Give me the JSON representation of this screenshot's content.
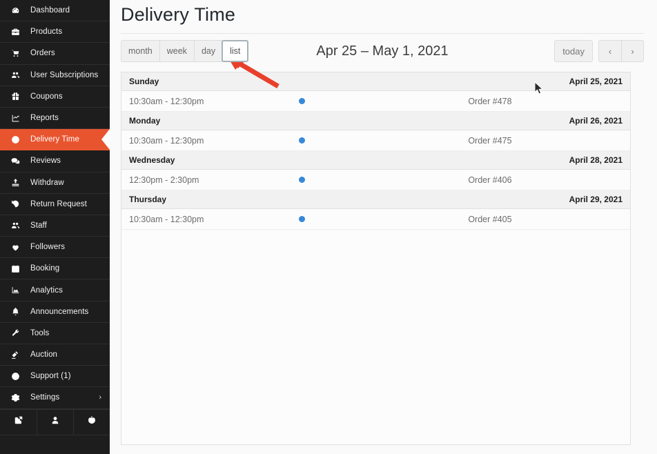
{
  "colors": {
    "sidebar_bg": "#1d1d1d",
    "accent": "#e8542e",
    "event_dot": "#3788d8",
    "annotation_arrow": "#e8402c"
  },
  "sidebar": {
    "items": [
      {
        "label": "Dashboard",
        "icon": "dashboard-icon",
        "active": false
      },
      {
        "label": "Products",
        "icon": "briefcase-icon",
        "active": false
      },
      {
        "label": "Orders",
        "icon": "cart-icon",
        "active": false
      },
      {
        "label": "User Subscriptions",
        "icon": "users-icon",
        "active": false
      },
      {
        "label": "Coupons",
        "icon": "gift-icon",
        "active": false
      },
      {
        "label": "Reports",
        "icon": "chart-line-icon",
        "active": false
      },
      {
        "label": "Delivery Time",
        "icon": "clock-icon",
        "active": true
      },
      {
        "label": "Reviews",
        "icon": "comment-icon",
        "active": false
      },
      {
        "label": "Withdraw",
        "icon": "upload-icon",
        "active": false
      },
      {
        "label": "Return Request",
        "icon": "undo-icon",
        "active": false
      },
      {
        "label": "Staff",
        "icon": "users-icon",
        "active": false
      },
      {
        "label": "Followers",
        "icon": "heart-icon",
        "active": false
      },
      {
        "label": "Booking",
        "icon": "calendar-icon",
        "active": false
      },
      {
        "label": "Analytics",
        "icon": "area-chart-icon",
        "active": false
      },
      {
        "label": "Announcements",
        "icon": "bell-icon",
        "active": false
      },
      {
        "label": "Tools",
        "icon": "wrench-icon",
        "active": false
      },
      {
        "label": "Auction",
        "icon": "gavel-icon",
        "active": false
      },
      {
        "label": "Support (1)",
        "icon": "lifering-icon",
        "active": false
      },
      {
        "label": "Settings",
        "icon": "gear-icon",
        "active": false,
        "chevron": "›"
      }
    ],
    "bottom_actions": [
      {
        "name": "visit-store",
        "icon": "external-link-icon"
      },
      {
        "name": "profile",
        "icon": "user-icon"
      },
      {
        "name": "logout",
        "icon": "power-icon"
      }
    ]
  },
  "header": {
    "title": "Delivery Time"
  },
  "toolbar": {
    "views": [
      {
        "label": "month",
        "focused": false
      },
      {
        "label": "week",
        "focused": false
      },
      {
        "label": "day",
        "focused": false
      },
      {
        "label": "list",
        "focused": true
      }
    ],
    "range_title": "Apr 25 – May 1, 2021",
    "today_label": "today",
    "prev_label": "‹",
    "next_label": "›"
  },
  "calendar": {
    "groups": [
      {
        "day_name": "Sunday",
        "day_date": "April 25, 2021",
        "events": [
          {
            "time": "10:30am - 12:30pm",
            "title": "Order #478",
            "dot_color": "#3788d8"
          }
        ]
      },
      {
        "day_name": "Monday",
        "day_date": "April 26, 2021",
        "events": [
          {
            "time": "10:30am - 12:30pm",
            "title": "Order #475",
            "dot_color": "#3788d8"
          }
        ]
      },
      {
        "day_name": "Wednesday",
        "day_date": "April 28, 2021",
        "events": [
          {
            "time": "12:30pm - 2:30pm",
            "title": "Order #406",
            "dot_color": "#3788d8"
          }
        ]
      },
      {
        "day_name": "Thursday",
        "day_date": "April 29, 2021",
        "events": [
          {
            "time": "10:30am - 12:30pm",
            "title": "Order #405",
            "dot_color": "#3788d8"
          }
        ]
      }
    ]
  },
  "annotation": {
    "type": "arrow",
    "points_to": "list-view-button",
    "color": "#e8402c"
  }
}
